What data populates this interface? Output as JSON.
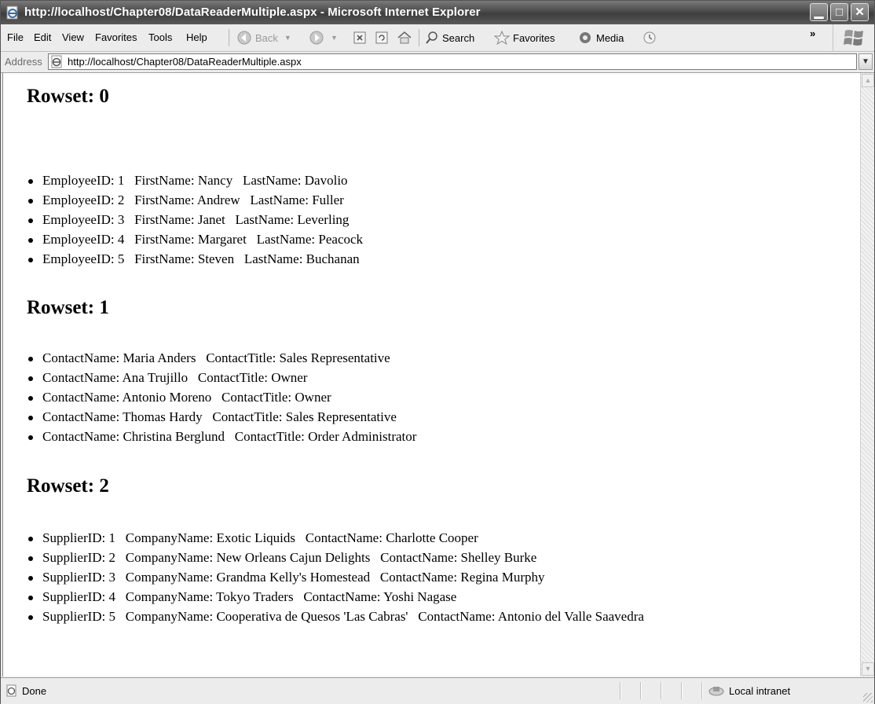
{
  "window": {
    "title": "http://localhost/Chapter08/DataReaderMultiple.aspx - Microsoft Internet Explorer"
  },
  "menu": {
    "items": [
      "File",
      "Edit",
      "View",
      "Favorites",
      "Tools",
      "Help"
    ]
  },
  "toolbar": {
    "back_label": "Back",
    "search_label": "Search",
    "favorites_label": "Favorites",
    "media_label": "Media",
    "chevron": "»"
  },
  "address": {
    "label": "Address",
    "url": "http://localhost/Chapter08/DataReaderMultiple.aspx"
  },
  "page": {
    "rowsets": [
      {
        "heading": "Rowset: 0",
        "rows": [
          "EmployeeID: 1   FirstName: Nancy   LastName: Davolio",
          "EmployeeID: 2   FirstName: Andrew   LastName: Fuller",
          "EmployeeID: 3   FirstName: Janet   LastName: Leverling",
          "EmployeeID: 4   FirstName: Margaret   LastName: Peacock",
          "EmployeeID: 5   FirstName: Steven   LastName: Buchanan"
        ]
      },
      {
        "heading": "Rowset: 1",
        "rows": [
          "ContactName: Maria Anders   ContactTitle: Sales Representative",
          "ContactName: Ana Trujillo   ContactTitle: Owner",
          "ContactName: Antonio Moreno   ContactTitle: Owner",
          "ContactName: Thomas Hardy   ContactTitle: Sales Representative",
          "ContactName: Christina Berglund   ContactTitle: Order Administrator"
        ]
      },
      {
        "heading": "Rowset: 2",
        "rows": [
          "SupplierID: 1   CompanyName: Exotic Liquids   ContactName: Charlotte Cooper",
          "SupplierID: 2   CompanyName: New Orleans Cajun Delights   ContactName: Shelley Burke",
          "SupplierID: 3   CompanyName: Grandma Kelly's Homestead   ContactName: Regina Murphy",
          "SupplierID: 4   CompanyName: Tokyo Traders   ContactName: Yoshi Nagase",
          "SupplierID: 5   CompanyName: Cooperativa de Quesos 'Las Cabras'   ContactName: Antonio del Valle Saavedra"
        ]
      }
    ]
  },
  "status": {
    "text": "Done",
    "zone": "Local intranet"
  }
}
